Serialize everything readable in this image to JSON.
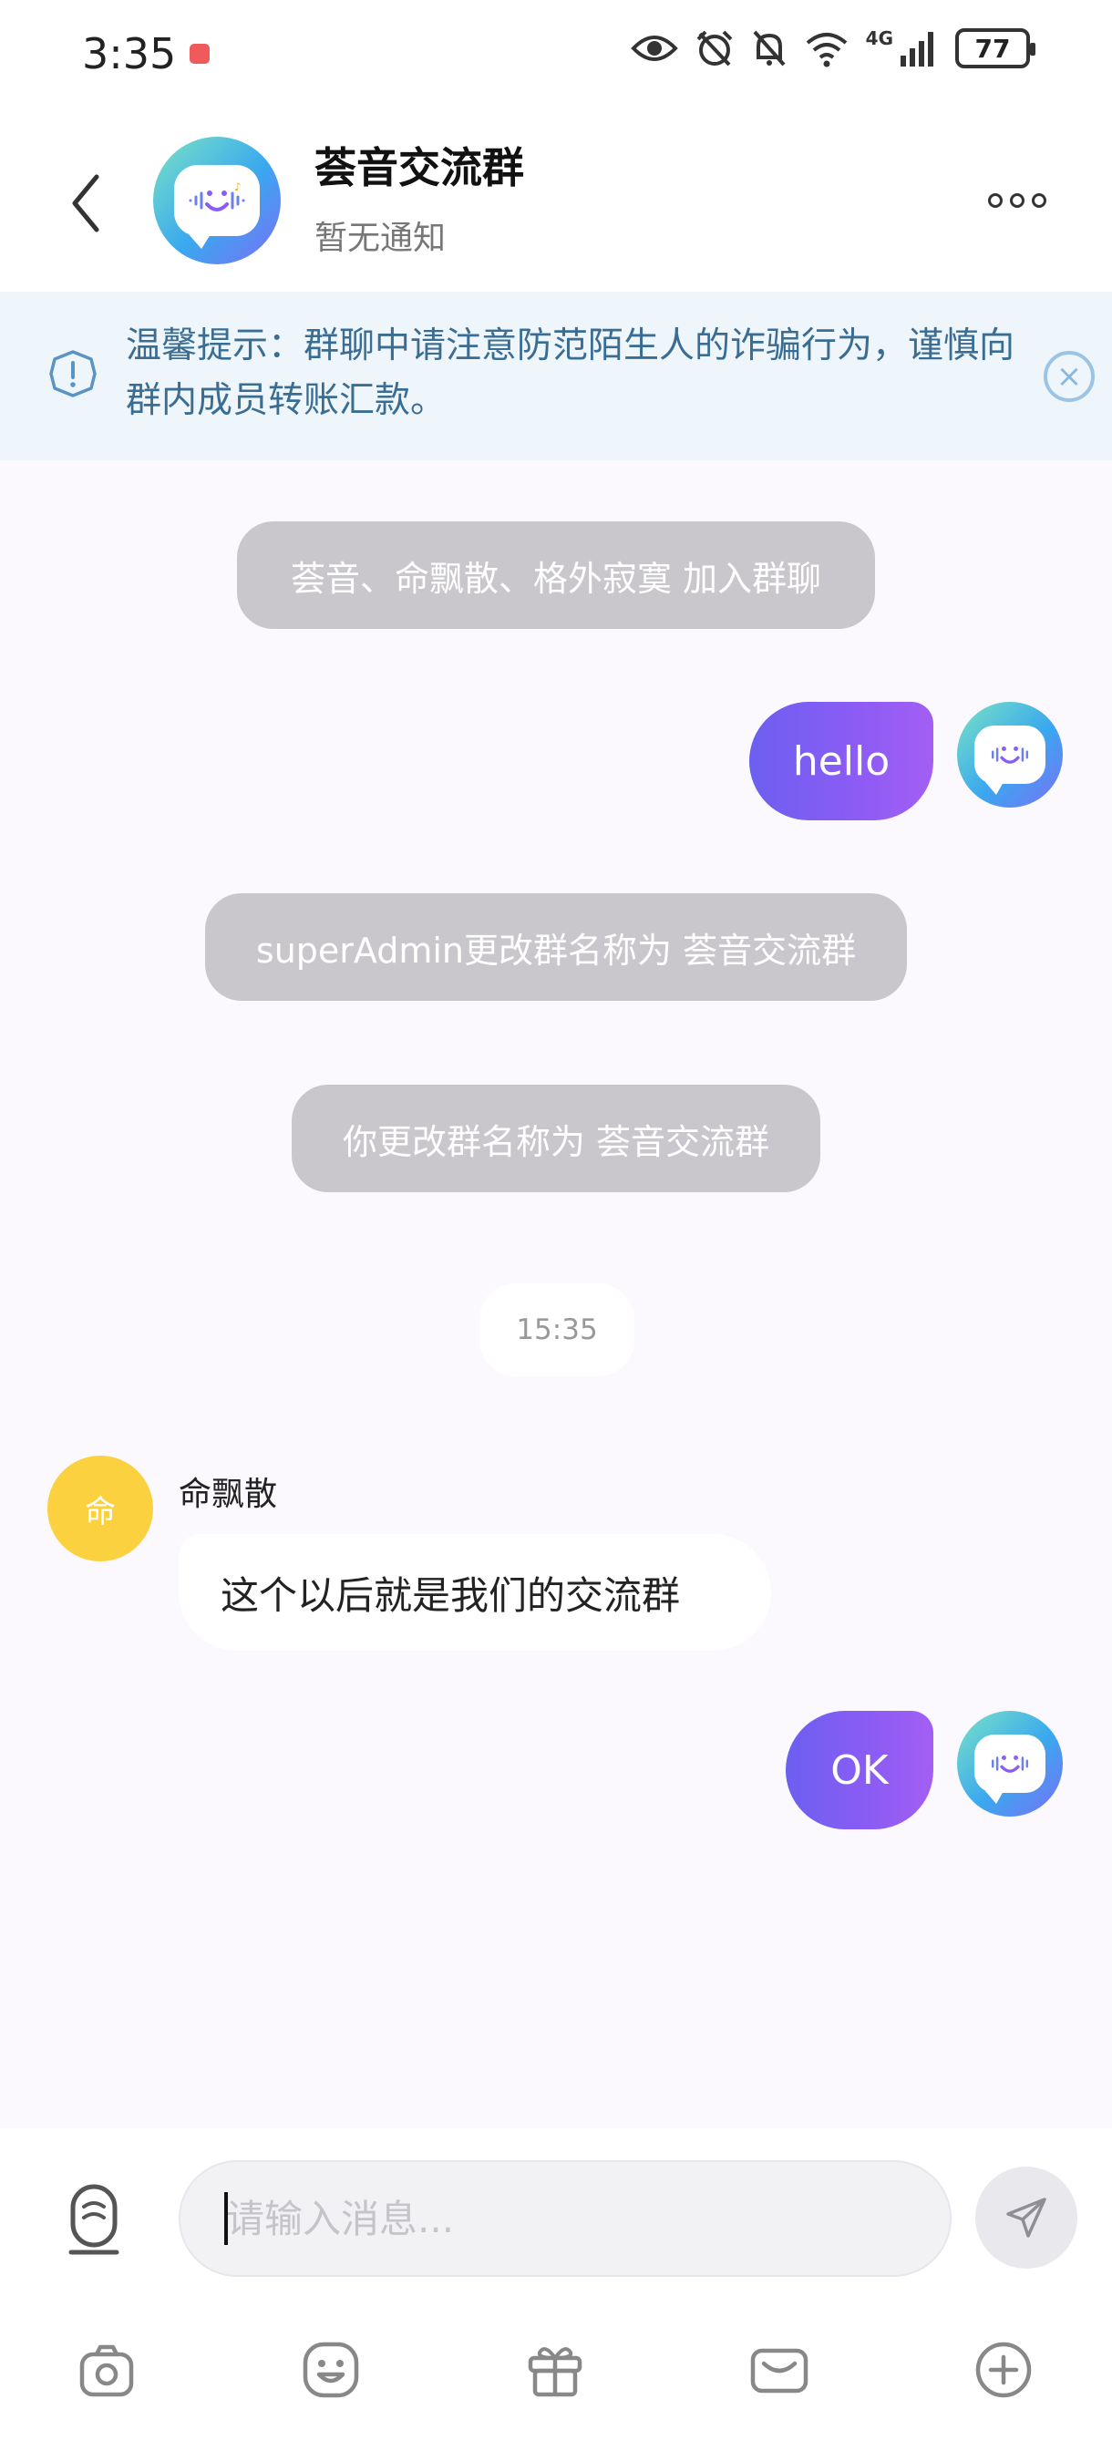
{
  "status_bar": {
    "time": "3:35",
    "battery": "77",
    "network": "4G"
  },
  "header": {
    "title": "荟音交流群",
    "subtitle": "暂无通知"
  },
  "warning": {
    "text": "温馨提示：群聊中请注意防范陌生人的诈骗行为，谨慎向群内成员转账汇款。"
  },
  "messages": {
    "sys_join": "荟音、命飘散、格外寂寞 加入群聊",
    "me_hello": "hello",
    "sys_rename_admin": "superAdmin更改群名称为 荟音交流群",
    "sys_rename_you": "你更改群名称为 荟音交流群",
    "timestamp": "15:35",
    "other_avatar_char": "命",
    "other_name": "命飘散",
    "other_text": "这个以后就是我们的交流群",
    "me_ok": "OK"
  },
  "input": {
    "placeholder": "请输入消息..."
  },
  "colors": {
    "accent_start": "#6c5ff0",
    "accent_end": "#a35ef3",
    "warning_bg": "#eef6fc",
    "warning_text": "#3b6d93",
    "system_pill": "#c9c7cb",
    "other_avatar": "#fbd13f"
  },
  "icons": {
    "back": "chevron-left-icon",
    "more": "more-dots-icon",
    "warning": "exclamation-shield-icon",
    "close": "close-circle-icon",
    "voice": "voice-icon",
    "send": "send-icon",
    "toolbar": [
      "camera-icon",
      "emoji-icon",
      "gift-icon",
      "envelope-icon",
      "plus-circle-icon"
    ]
  }
}
